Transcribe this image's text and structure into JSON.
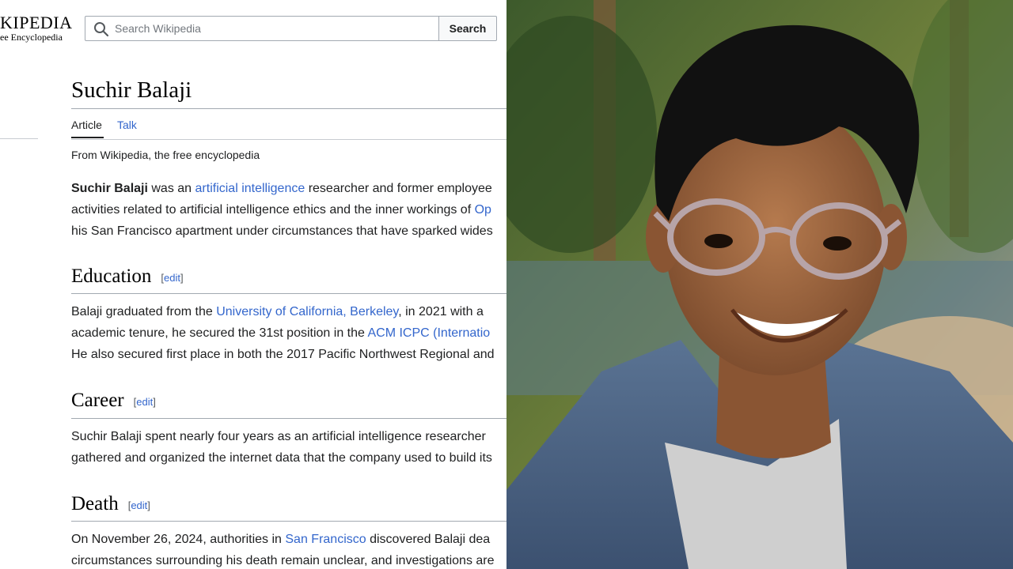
{
  "logo": {
    "wordmark": "KIPEDIA",
    "tagline": "ee Encyclopedia"
  },
  "search": {
    "placeholder": "Search Wikipedia",
    "button_label": "Search"
  },
  "article": {
    "title": "Suchir Balaji",
    "tabs": [
      {
        "label": "Article"
      },
      {
        "label": "Talk"
      }
    ],
    "tagline": "From Wikipedia, the free encyclopedia",
    "intro": {
      "bold": "Suchir Balaji",
      "t1": " was an ",
      "link1": "artificial intelligence",
      "t2": " researcher and former employee",
      "line2": "activities related to artificial intelligence ethics and the inner workings of ",
      "link2": "Op",
      "line3": "his San Francisco apartment under circumstances that have sparked wides"
    },
    "edit_label": "edit",
    "sections": {
      "education": {
        "heading": "Education",
        "l1a": "Balaji graduated from the ",
        "l1link": "University of California, Berkeley",
        "l1b": ", in 2021 with a ",
        "l2a": "academic tenure, he secured the 31st position in the ",
        "l2link": "ACM ICPC (Internatio",
        "l3": "He also secured first place in both the 2017 Pacific Northwest Regional and"
      },
      "career": {
        "heading": "Career",
        "l1": "Suchir Balaji spent nearly four years as an artificial intelligence researcher",
        "l2": "gathered and organized the internet data that the company used to build its"
      },
      "death": {
        "heading": "Death",
        "l1a": "On November 26, 2024, authorities in ",
        "l1link": "San Francisco",
        "l1b": " discovered Balaji dea",
        "l2": "circumstances surrounding his death remain unclear, and investigations are"
      }
    }
  },
  "photo": {
    "subject": "portrait of a smiling young man with glasses in a denim jacket"
  },
  "colors": {
    "link": "#3366cc",
    "text": "#202122",
    "rule": "#a2a9b1"
  }
}
